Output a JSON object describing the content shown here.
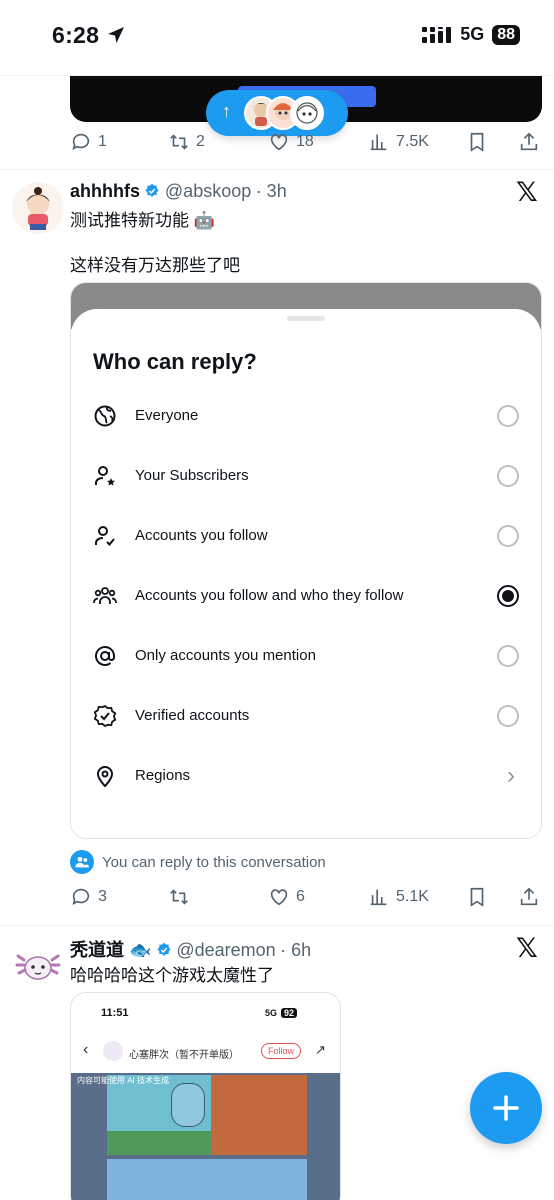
{
  "status_bar": {
    "time": "6:28",
    "network": "5G",
    "battery": "88"
  },
  "tweets": [
    {
      "actions": {
        "replies": "1",
        "reposts": "2",
        "likes": "18",
        "views": "7.5K"
      }
    },
    {
      "name": "ahhhhfs",
      "handle": "@abskoop",
      "time": "· 3h",
      "text_line1": "测试推特新功能 🤖",
      "text_line2": "这样没有万达那些了吧",
      "reply_sheet": {
        "title": "Who can reply?",
        "options": [
          {
            "label": "Everyone",
            "icon": "globe-icon",
            "selected": false
          },
          {
            "label": "Your Subscribers",
            "icon": "subscriber-icon",
            "selected": false
          },
          {
            "label": "Accounts you follow",
            "icon": "person-check-icon",
            "selected": false
          },
          {
            "label": "Accounts you follow and who they follow",
            "icon": "people-icon",
            "selected": true
          },
          {
            "label": "Only accounts you mention",
            "icon": "at-icon",
            "selected": false
          },
          {
            "label": "Verified accounts",
            "icon": "verified-badge-icon",
            "selected": false
          },
          {
            "label": "Regions",
            "icon": "location-pin-icon",
            "selected": false
          }
        ]
      },
      "reply_note": "You can reply to this conversation",
      "actions": {
        "replies": "3",
        "reposts": "",
        "likes": "6",
        "views": "5.1K"
      }
    },
    {
      "name": "秃道道 🐟",
      "handle": "@dearemon",
      "time": "· 6h",
      "text_line1": "哈哈哈哈这个游戏太魔性了",
      "embedded": {
        "time": "11:51",
        "network": "5G",
        "battery": "92",
        "title": "心塞胖次（暂不开单版）",
        "follow_label": "Follow",
        "ai_notice": "内容可能使用 AI 技术生成"
      }
    }
  ],
  "colors": {
    "accent": "#1d9bf0",
    "text": "#0f1419",
    "muted": "#536471"
  }
}
